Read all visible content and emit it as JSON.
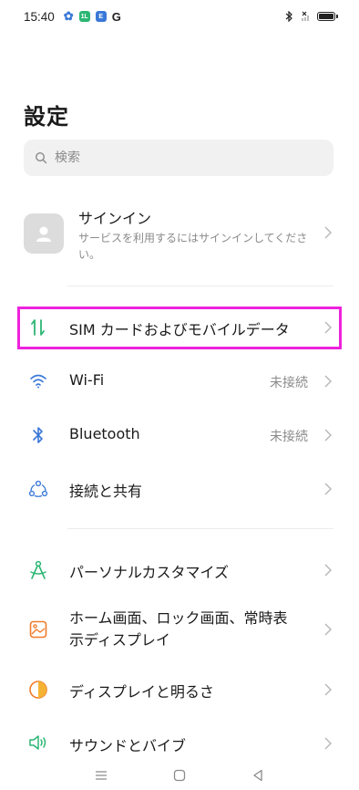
{
  "status_bar": {
    "time": "15:40",
    "icons": [
      "gear-icon",
      "app-badge-green",
      "app-badge-blue",
      "google-g"
    ],
    "badge1": "1L",
    "badge2": "E",
    "g_letter": "G",
    "right_icons": [
      "bluetooth-icon",
      "no-signal-icon",
      "battery-icon"
    ]
  },
  "page": {
    "title": "設定"
  },
  "search": {
    "placeholder": "検索"
  },
  "account": {
    "name": "サインイン",
    "description": "サービスを利用するにはサインインしてください。"
  },
  "settings": {
    "sim": {
      "label": "SIM カードおよびモバイルデータ",
      "icon": "sim-data-icon"
    },
    "wifi": {
      "label": "Wi-Fi",
      "value": "未接続",
      "icon": "wifi-icon"
    },
    "bluetooth": {
      "label": "Bluetooth",
      "value": "未接続",
      "icon": "bluetooth-icon"
    },
    "connection": {
      "label": "接続と共有",
      "icon": "share-connection-icon"
    },
    "personalize": {
      "label": "パーソナルカスタマイズ",
      "icon": "compass-personalize-icon"
    },
    "homescreen": {
      "label_line1": "ホーム画面、ロック画面、常時表",
      "label_line2": "示ディスプレイ",
      "icon": "homescreen-icon"
    },
    "display": {
      "label": "ディスプレイと明るさ",
      "icon": "display-brightness-icon"
    },
    "sound": {
      "label": "サウンドとバイブ",
      "icon": "sound-icon"
    }
  },
  "colors": {
    "highlight": "#ee22dd",
    "green": "#2bb673",
    "blue": "#3a78d8",
    "orange": "#f07b2a"
  },
  "navigation": [
    "menu-icon",
    "home-icon",
    "back-icon"
  ]
}
